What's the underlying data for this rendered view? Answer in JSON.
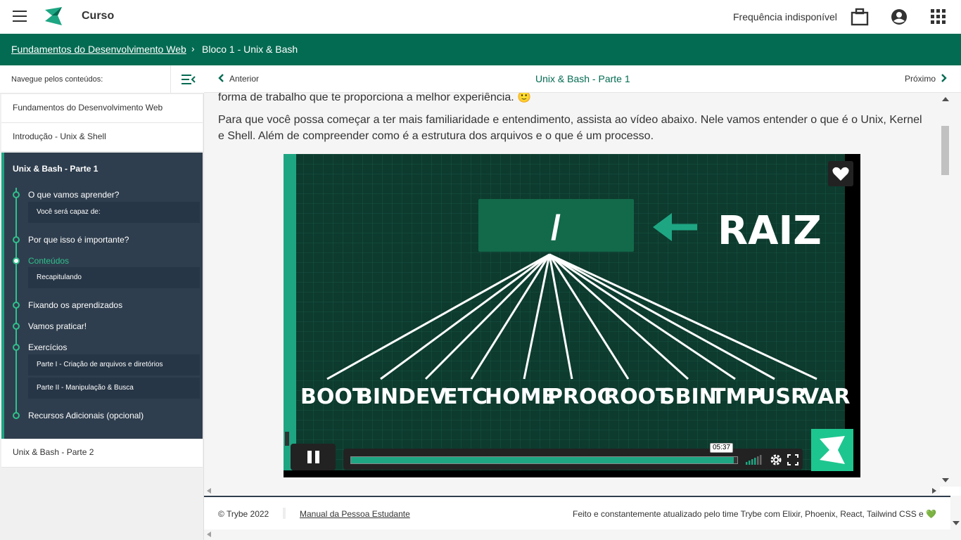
{
  "topbar": {
    "title": "Curso",
    "attendance": "Frequência indisponível",
    "icons": [
      "menu-icon",
      "trybe-logo",
      "briefcase-icon",
      "account-circle-icon",
      "apps-grid-icon"
    ]
  },
  "breadcrumb": {
    "module": "Fundamentos do Desenvolvimento Web",
    "separator": "›",
    "block": "Bloco 1 - Unix & Bash"
  },
  "sidebar": {
    "header": "Navegue pelos conteúdos:",
    "items": [
      "Fundamentos do Desenvolvimento Web",
      "Introdução - Unix & Shell"
    ],
    "active_section": {
      "title": "Unix & Bash - Parte 1",
      "topics": [
        {
          "label": "O que vamos aprender?",
          "subs": [
            "Você será capaz de:"
          ]
        },
        {
          "label": "Por que isso é importante?",
          "subs": []
        },
        {
          "label": "Conteúdos",
          "subs": [
            "Recapitulando"
          ],
          "active": true
        },
        {
          "label": "Fixando os aprendizados",
          "subs": []
        },
        {
          "label": "Vamos praticar!",
          "subs": []
        },
        {
          "label": "Exercícios",
          "subs": [
            "Parte I - Criação de arquivos e diretórios",
            "Parte II - Manipulação & Busca"
          ]
        },
        {
          "label": "Recursos Adicionais (opcional)",
          "subs": []
        }
      ]
    },
    "next_section": "Unix & Bash - Parte 2"
  },
  "content_header": {
    "prev": "Anterior",
    "title": "Unix & Bash - Parte 1",
    "next": "Próximo"
  },
  "content": {
    "paragraph_top": "forma de trabalho que te proporciona a melhor experiência. 🙂",
    "paragraph_line1": "Para que você possa começar a ter mais familiaridade e entendimento, assista ao vídeo abaixo. Nele vamos entender o que é o Unix, Kernel",
    "paragraph_line2": "e Shell. Além de compreender como é a estrutura dos arquivos e o que é um processo."
  },
  "video": {
    "root_box": "/",
    "root_label": "RAIZ",
    "dirs": [
      "BOOT",
      "BIN",
      "DEV",
      "ETC",
      "HOME",
      "PROC",
      "ROOT",
      "SBIN",
      "TMP",
      "USR",
      "VAR"
    ],
    "time_tooltip": "05:37",
    "progress": 0.99,
    "colors": {
      "bg": "#0d3b2e",
      "accent": "#1ea683"
    }
  },
  "footer": {
    "copyright": "© Trybe 2022",
    "manual": "Manual da Pessoa Estudante",
    "credits": "Feito e constantemente atualizado pelo time Trybe com Elixir, Phoenix, React, Tailwind CSS e 💚"
  },
  "colors": {
    "brand_green": "#036b52",
    "accent_green": "#2fc18c",
    "sidebar_dark": "#2f3e4e"
  }
}
